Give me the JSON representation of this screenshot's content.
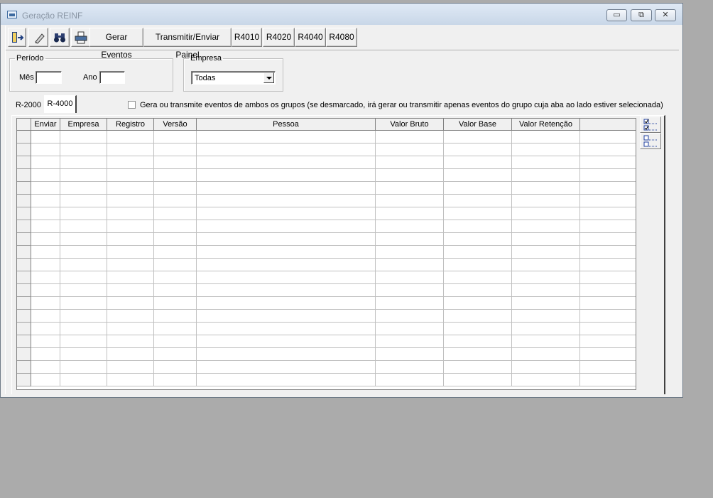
{
  "window": {
    "title": "Geração REINF",
    "controls": {
      "minimize": "▭",
      "maximize": "⧉",
      "close": "✕"
    }
  },
  "toolbar": {
    "icons": [
      "exit-door-icon",
      "eraser-icon",
      "binoculars-icon",
      "printer-icon"
    ],
    "buttons": [
      "Gerar Eventos",
      "Transmitir/Enviar Painel",
      "R4010",
      "R4020",
      "R4040",
      "R4080"
    ]
  },
  "periodo": {
    "legend": "Período",
    "mes_label": "Mês",
    "mes_value": "",
    "ano_label": "Ano",
    "ano_value": ""
  },
  "empresa": {
    "legend": "Empresa",
    "selected": "Todas"
  },
  "tabs": [
    {
      "label": "R-2000",
      "active": false
    },
    {
      "label": "R-4000",
      "active": true
    }
  ],
  "option": {
    "checked": false,
    "label": "Gera ou transmite eventos de ambos os grupos (se desmarcado, irá gerar ou transmitir apenas eventos do grupo cuja aba ao lado estiver selecionada)"
  },
  "grid": {
    "columns": [
      "Enviar",
      "Empresa",
      "Registro",
      "Versão",
      "Pessoa",
      "Valor Bruto",
      "Valor Base",
      "Valor Retenção"
    ],
    "rows": []
  },
  "side_buttons": [
    "check-all-icon",
    "uncheck-all-icon"
  ],
  "colors": {
    "desktop": "#ababab",
    "window_bg": "#f0f0f0",
    "title_text": "#8a96a5"
  }
}
